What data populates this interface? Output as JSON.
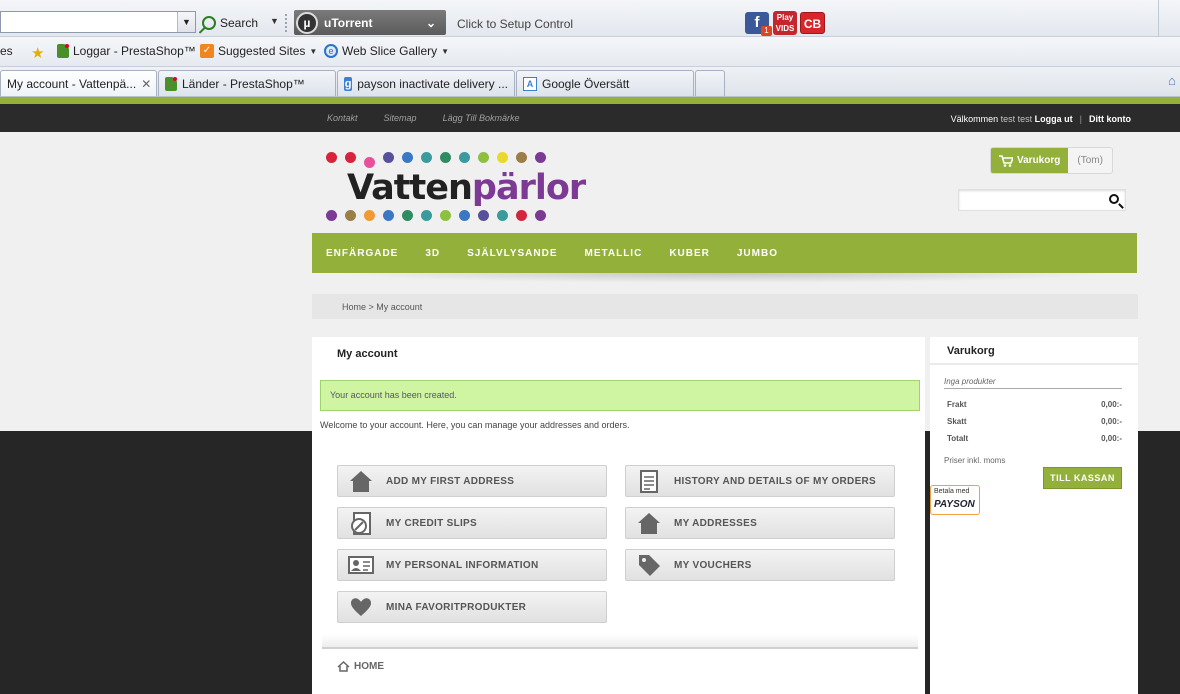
{
  "browser": {
    "search_label": "Search",
    "utorrent_label": "uTorrent",
    "setup_label": "Click to Setup Control",
    "fb_badge": "1",
    "play_label": "Play",
    "vids_label": "VIDS",
    "cb_label": "CB",
    "favorites": {
      "cut_label": "es",
      "item1": "Loggar - PrestaShop™",
      "item2": "Suggested Sites",
      "item3": "Web Slice Gallery"
    },
    "tabs": [
      {
        "label": "My account - Vattenpä..."
      },
      {
        "label": "Länder - PrestaShop™"
      },
      {
        "label": "payson inactivate delivery ..."
      },
      {
        "label": "Google Översätt"
      }
    ]
  },
  "topbar": {
    "links": [
      "Kontakt",
      "Sitemap",
      "Lägg Till Bokmärke"
    ],
    "welcome": "Välkommen",
    "user": "test test",
    "logout": "Logga ut",
    "account": "Ditt konto"
  },
  "logo": {
    "part1": "Vatten",
    "part2": "pärlor"
  },
  "cart_button": {
    "label": "Varukorg",
    "status": "(Tom)"
  },
  "search": {
    "placeholder": ""
  },
  "nav": [
    "ENFÄRGADE",
    "3D",
    "SJÄLVLYSANDE",
    "METALLIC",
    "KUBER",
    "JUMBO"
  ],
  "breadcrumb": "Home > My account",
  "main": {
    "title": "My account",
    "alert": "Your account has been created.",
    "welcome": "Welcome to your account. Here, you can manage your addresses and orders.",
    "buttons": {
      "add_address": "ADD MY FIRST ADDRESS",
      "history": "HISTORY AND DETAILS OF MY ORDERS",
      "credit_slips": "MY CREDIT SLIPS",
      "addresses": "MY ADDRESSES",
      "personal_info": "MY PERSONAL INFORMATION",
      "vouchers": "MY VOUCHERS",
      "favorites": "MINA FAVORITPRODUKTER"
    },
    "home_link": "HOME"
  },
  "sidebar": {
    "title": "Varukorg",
    "empty": "Inga produkter",
    "rows": [
      {
        "label": "Frakt",
        "value": "0,00:-"
      },
      {
        "label": "Skatt",
        "value": "0,00:-"
      },
      {
        "label": "Totalt",
        "value": "0,00:-"
      }
    ],
    "note": "Priser inkl. moms",
    "checkout": "TILL KASSAN",
    "payson_caption": "Betala med",
    "payson_logo": "PAYSON"
  },
  "colors": {
    "accent": "#93b03a",
    "alert_bg": "#cff5a2",
    "topbar": "#2b2b2b"
  }
}
